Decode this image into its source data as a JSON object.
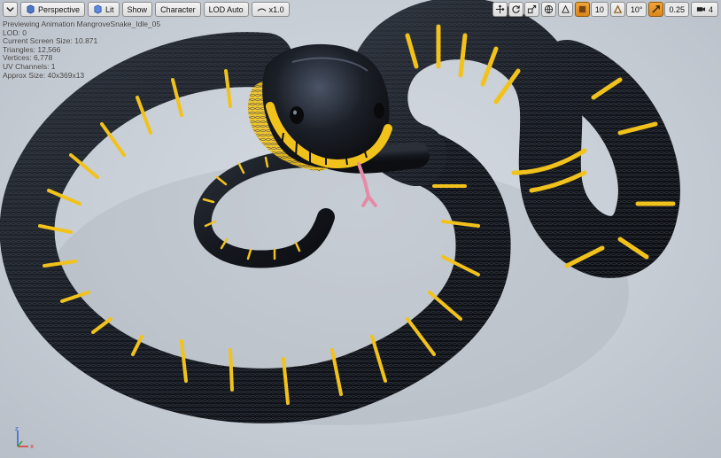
{
  "toolbar": {
    "view_mode_label": "Perspective",
    "lit_label": "Lit",
    "show_label": "Show",
    "character_label": "Character",
    "lod_label": "LOD Auto",
    "playback_speed": "x1.0"
  },
  "right_toolbar": {
    "grid_snap_value": "10",
    "rotation_snap_value": "10°",
    "scale_snap_value": "0.25",
    "camera_speed_value": "4"
  },
  "stats": {
    "line1": "Previewing Animation MangroveSnake_Idle_05",
    "line2": "LOD: 0",
    "line3": "Current Screen Size: 10.871",
    "line4": "Triangles: 12,566",
    "line5": "Vertices: 6,778",
    "line6": "UV Channels: 1",
    "line7": "Approx Size: 40x369x13"
  },
  "axis": {
    "x_label": "x",
    "z_label": "z"
  },
  "icons": {
    "menu": "chevron-down-icon",
    "perspective": "perspective-cube-icon",
    "lit": "lit-sphere-icon",
    "playback": "playback-speed-icon",
    "translate": "translate-icon",
    "rotate": "rotate-icon",
    "scale": "scale-icon",
    "world": "world-local-icon",
    "surface_snap": "surface-snap-icon",
    "grid_snap": "grid-snap-icon",
    "angle_snap": "angle-snap-icon",
    "scale_snap": "scale-snap-icon",
    "camera_speed": "camera-speed-icon"
  },
  "colors": {
    "active_orange": "#e89a2c",
    "snake_body": "#15171c",
    "snake_band": "#f2c21c",
    "tongue": "#e58aa6"
  }
}
